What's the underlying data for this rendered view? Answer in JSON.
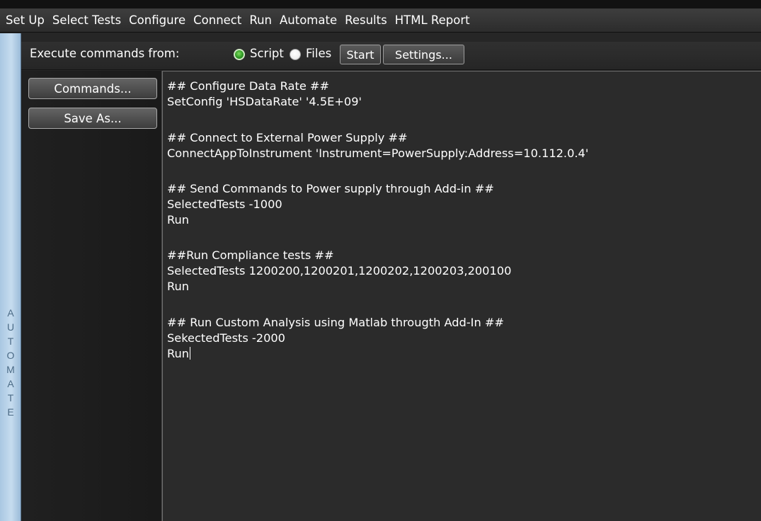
{
  "menu": {
    "items": [
      "Set Up",
      "Select Tests",
      "Configure",
      "Connect",
      "Run",
      "Automate",
      "Results",
      "HTML Report"
    ]
  },
  "rail": {
    "label_letters": [
      "A",
      "U",
      "T",
      "O",
      "M",
      "A",
      "T",
      "E"
    ]
  },
  "execute": {
    "label": "Execute commands from:",
    "option_script": "Script",
    "option_files": "Files",
    "selected": "Script",
    "start_label": "Start",
    "settings_label": "Settings..."
  },
  "side_buttons": {
    "commands_label": "Commands...",
    "save_as_label": "Save As..."
  },
  "editor": {
    "lines": [
      "## Configure Data Rate ##",
      "SetConfig 'HSDataRate' '4.5E+09'",
      "",
      "## Connect to External Power Supply ##",
      "ConnectAppToInstrument 'Instrument=PowerSupply:Address=10.112.0.4'",
      "",
      "## Send Commands to Power supply through Add-in ##",
      "SelectedTests -1000",
      "Run",
      "",
      "##Run Compliance tests ##",
      "SelectedTests 1200200,1200201,1200202,1200203,200100",
      "Run",
      "",
      "## Run Custom Analysis using Matlab througth Add-In ##",
      "SekectedTests -2000",
      "Run"
    ]
  },
  "colors": {
    "rail_blue": "#c6dcef",
    "radio_selected": "#2f9a25",
    "background": "#262626"
  }
}
